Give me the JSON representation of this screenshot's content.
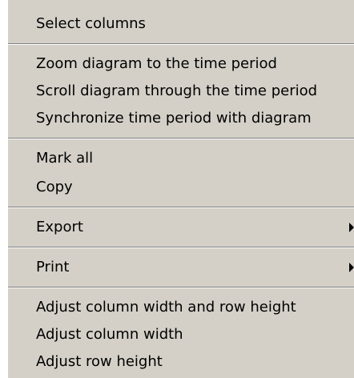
{
  "menu": {
    "select_columns": "Select columns",
    "zoom_diagram": "Zoom diagram to the time period",
    "scroll_diagram": "Scroll diagram through the time period",
    "synchronize_period": "Synchronize time period with diagram",
    "mark_all": "Mark all",
    "copy": "Copy",
    "export": "Export",
    "print": "Print",
    "adjust_width_height": "Adjust column width and row height",
    "adjust_width": "Adjust column width",
    "adjust_height": "Adjust row height"
  }
}
